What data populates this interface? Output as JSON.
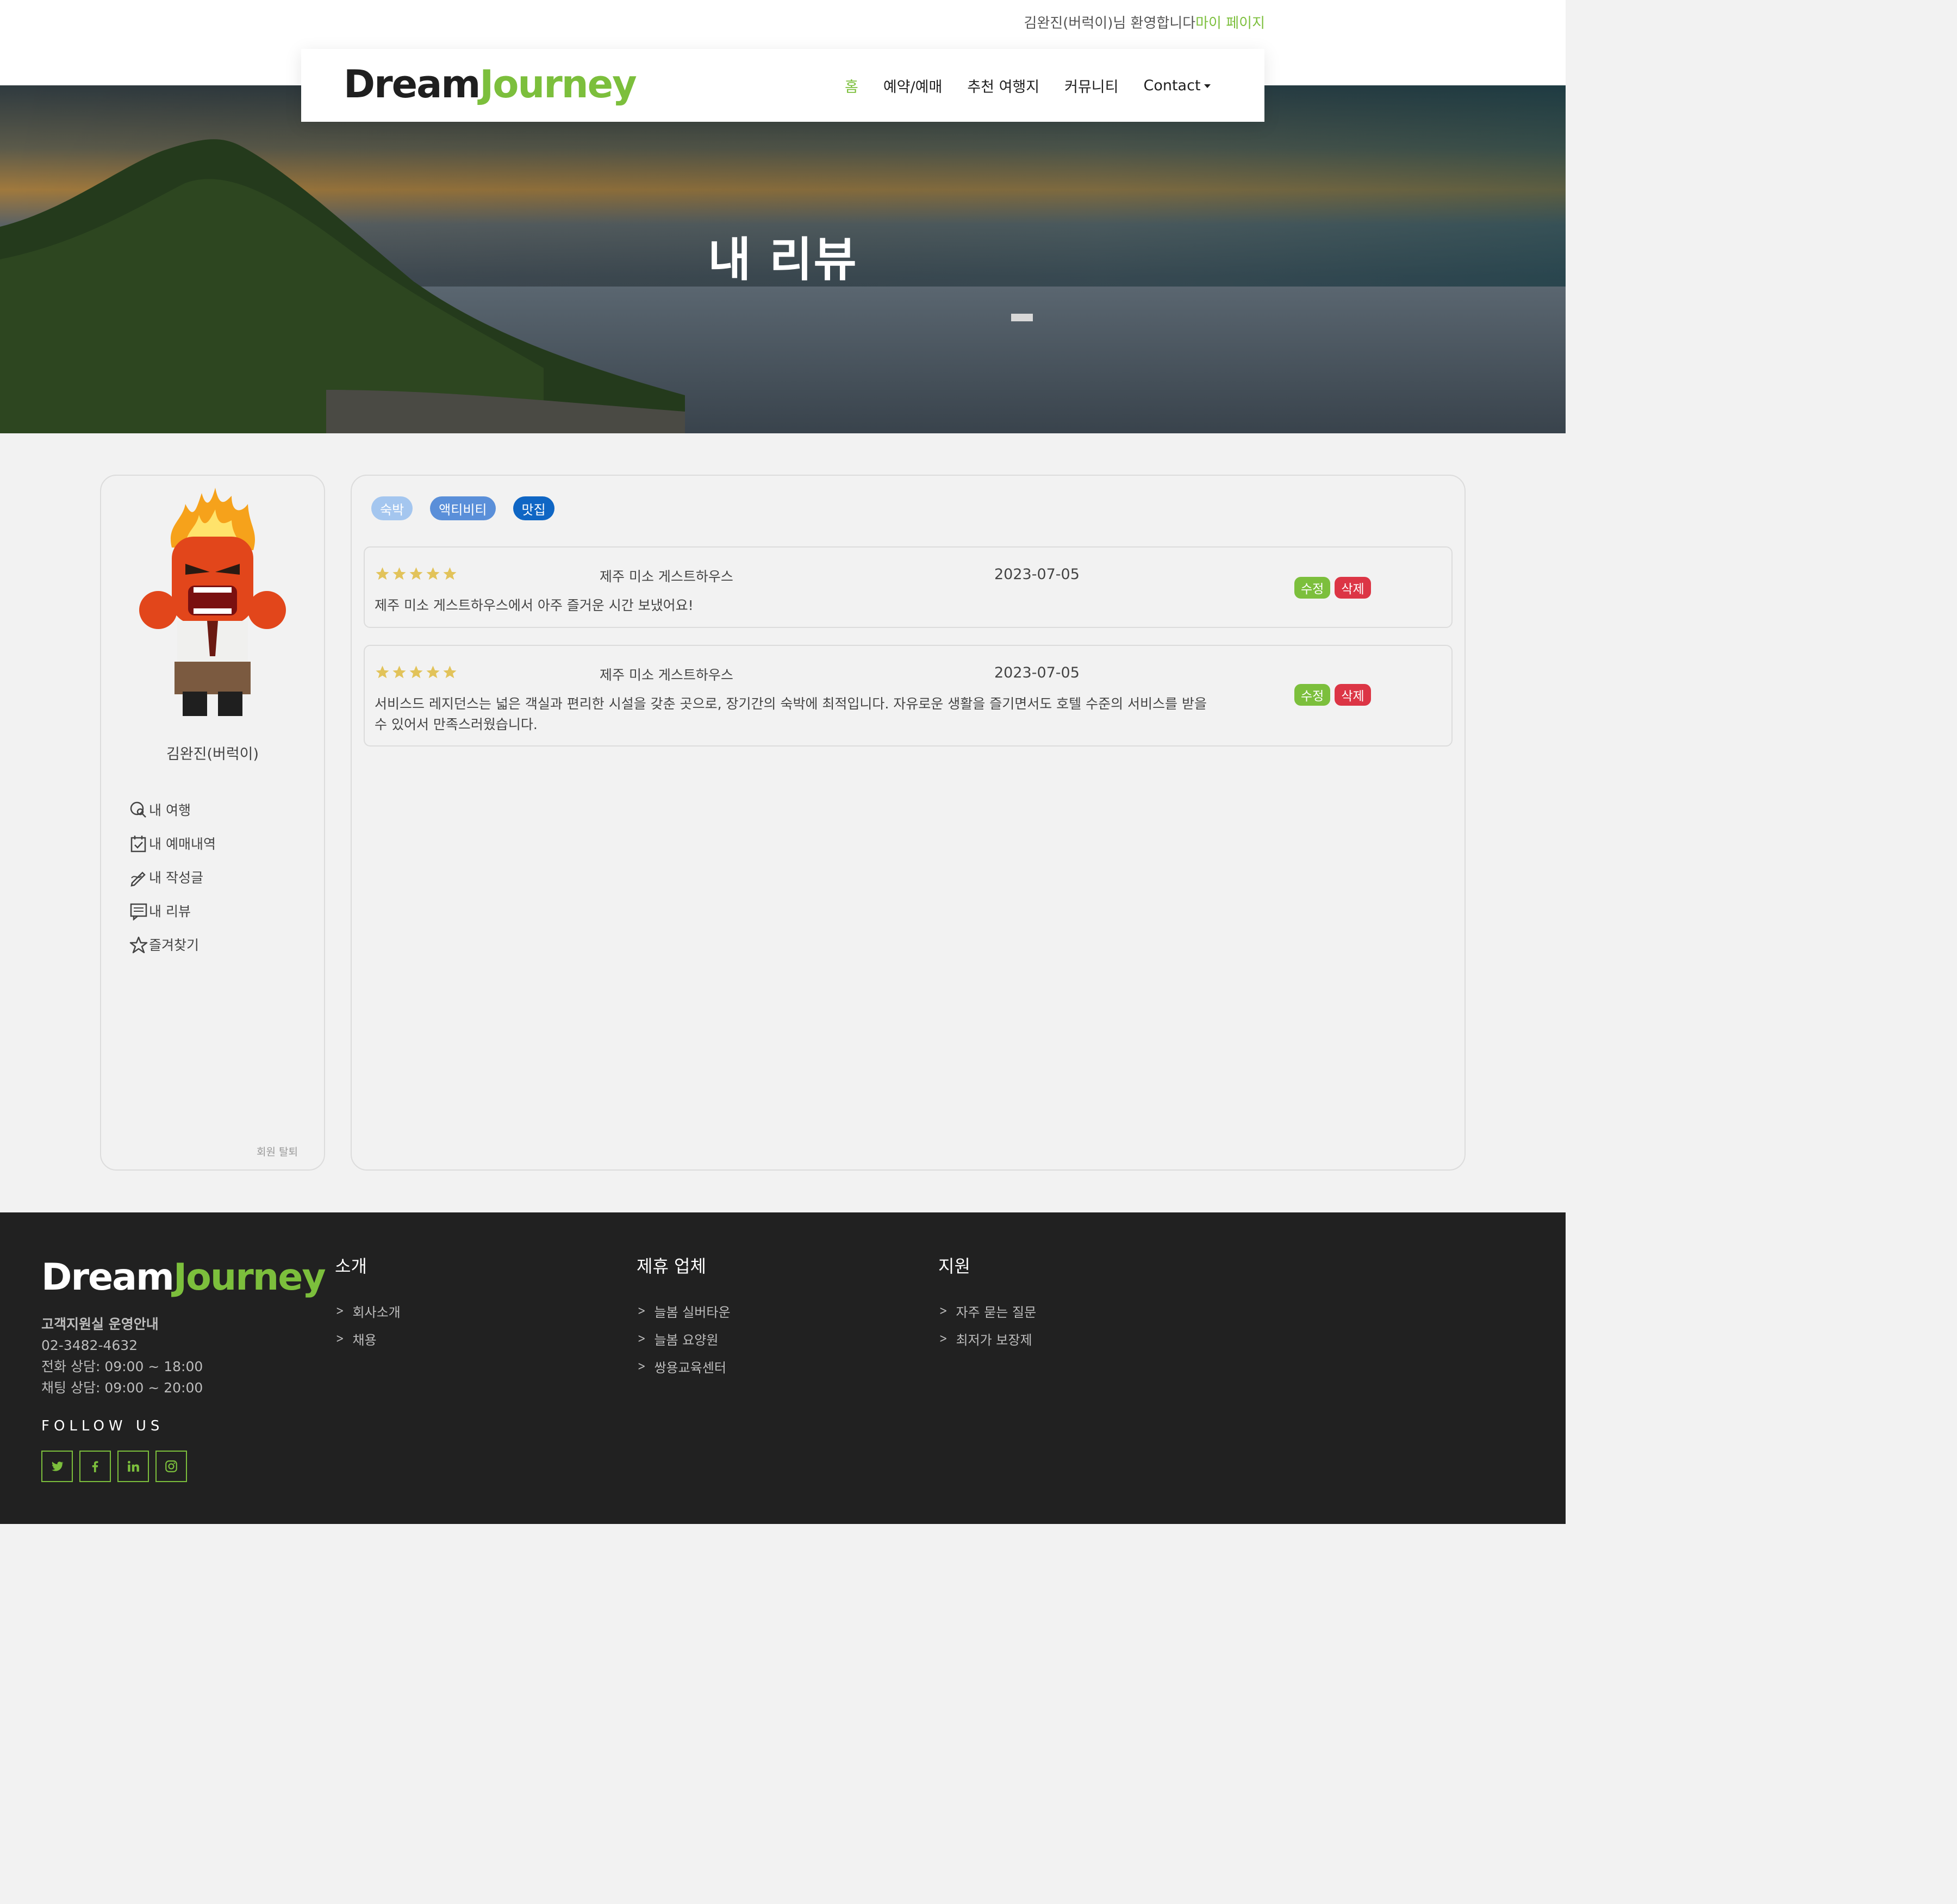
{
  "topbar": {
    "welcome": "김완진(버럭이)님 환영합니다",
    "mypage": "마이 페이지"
  },
  "navbar": {
    "logo_dream": "Dream",
    "logo_journey": "Journey",
    "items": [
      {
        "label": "홈",
        "active": true
      },
      {
        "label": "예약/예매"
      },
      {
        "label": "추천 여행지"
      },
      {
        "label": "커뮤니티"
      },
      {
        "label": "Contact"
      }
    ]
  },
  "hero": {
    "title": "내 리뷰"
  },
  "sidebar": {
    "username": "김완진(버럭이)",
    "menu": [
      {
        "label": "내 여행",
        "icon": "search-globe-icon"
      },
      {
        "label": "내 예매내역",
        "icon": "calendar-check-icon"
      },
      {
        "label": "내 작성글",
        "icon": "pen-icon"
      },
      {
        "label": "내 리뷰",
        "icon": "chat-list-icon"
      },
      {
        "label": "즐겨찾기",
        "icon": "star-outline-icon"
      }
    ],
    "withdraw": "회원 탈퇴"
  },
  "filters": [
    "숙박",
    "액티비티",
    "맛집"
  ],
  "reviews": [
    {
      "rating": 5,
      "place": "제주 미소 게스트하우스",
      "date": "2023-07-05",
      "content": "제주 미소 게스트하우스에서 아주 즐거운 시간 보냈어요!",
      "edit": "수정",
      "delete": "삭제"
    },
    {
      "rating": 5,
      "place": "제주 미소 게스트하우스",
      "date": "2023-07-05",
      "content": "서비스드 레지던스는 넓은 객실과 편리한 시설을 갖춘 곳으로, 장기간의 숙박에 최적입니다. 자유로운 생활을 즐기면서도 호텔 수준의 서비스를 받을 수 있어서 만족스러웠습니다.",
      "edit": "수정",
      "delete": "삭제"
    }
  ],
  "footer": {
    "logo_dream": "Dream",
    "logo_journey": "Journey",
    "info_title": "고객지원실 운영안내",
    "phone": "02-3482-4632",
    "call_hours": "전화 상담: 09:00 ~ 18:00",
    "chat_hours": "채팅 상담: 09:00 ~ 20:00",
    "follow": "FOLLOW US",
    "socials": [
      "twitter-icon",
      "facebook-icon",
      "linkedin-icon",
      "instagram-icon"
    ],
    "columns": [
      {
        "title": "소개",
        "links": [
          "회사소개",
          "채용"
        ]
      },
      {
        "title": "제휴 업체",
        "links": [
          "늘봄 실버타운",
          "늘봄 요양원",
          "쌍용교육센터"
        ]
      },
      {
        "title": "지원",
        "links": [
          "자주 묻는 질문",
          "최저가 보장제"
        ]
      }
    ]
  },
  "colors": {
    "accent": "#7cbf3c",
    "danger": "#dc3545",
    "star": "#e2c35a",
    "footer_bg": "#212121"
  }
}
